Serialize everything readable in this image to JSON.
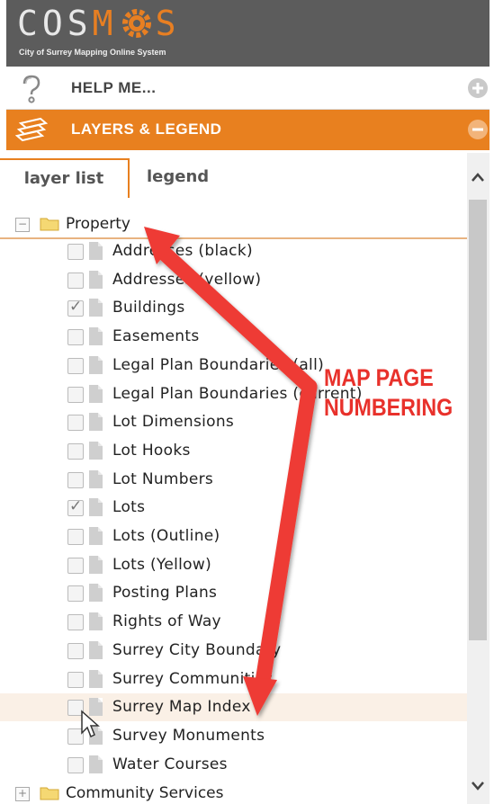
{
  "header": {
    "logo_letters": [
      "C",
      "O",
      "S",
      "M",
      "S"
    ],
    "tagline": "City of Surrey Mapping Online System",
    "accent": "#e87f22",
    "bg": "#5c5c5c"
  },
  "help": {
    "label": "HELP ME...",
    "icon": "question-icon",
    "toggle_icon": "plus-circle-icon"
  },
  "layers": {
    "label": "LAYERS & LEGEND",
    "icon": "layers-icon",
    "toggle_icon": "minus-circle-icon",
    "color": "#e8801f"
  },
  "tabs": {
    "layer_list": "layer list",
    "legend": "legend"
  },
  "tree": {
    "property": {
      "label": "Property",
      "expander": "−",
      "items": [
        {
          "label": "Addresses (black)",
          "checked": false
        },
        {
          "label": "Addresses (yellow)",
          "checked": false
        },
        {
          "label": "Buildings",
          "checked": true
        },
        {
          "label": "Easements",
          "checked": false
        },
        {
          "label": "Legal Plan Boundaries (all)",
          "checked": false
        },
        {
          "label": "Legal Plan Boundaries (current)",
          "checked": false
        },
        {
          "label": "Lot Dimensions",
          "checked": false
        },
        {
          "label": "Lot Hooks",
          "checked": false
        },
        {
          "label": "Lot Numbers",
          "checked": false
        },
        {
          "label": "Lots",
          "checked": true
        },
        {
          "label": "Lots (Outline)",
          "checked": false
        },
        {
          "label": "Lots (Yellow)",
          "checked": false
        },
        {
          "label": "Posting Plans",
          "checked": false
        },
        {
          "label": "Rights of Way",
          "checked": false
        },
        {
          "label": "Surrey City Boundary",
          "checked": false
        },
        {
          "label": "Surrey Communities",
          "checked": false
        },
        {
          "label": "Surrey Map Index",
          "checked": false,
          "highlighted": true
        },
        {
          "label": "Survey Monuments",
          "checked": false
        },
        {
          "label": "Water Courses",
          "checked": false
        }
      ]
    },
    "community": {
      "label": "Community Services",
      "expander": "+"
    }
  },
  "annotation": {
    "line1": "MAP PAGE",
    "line2": "NUMBERING",
    "color": "#e8312b"
  },
  "scrollbar": {
    "up": "^",
    "down": "v"
  }
}
